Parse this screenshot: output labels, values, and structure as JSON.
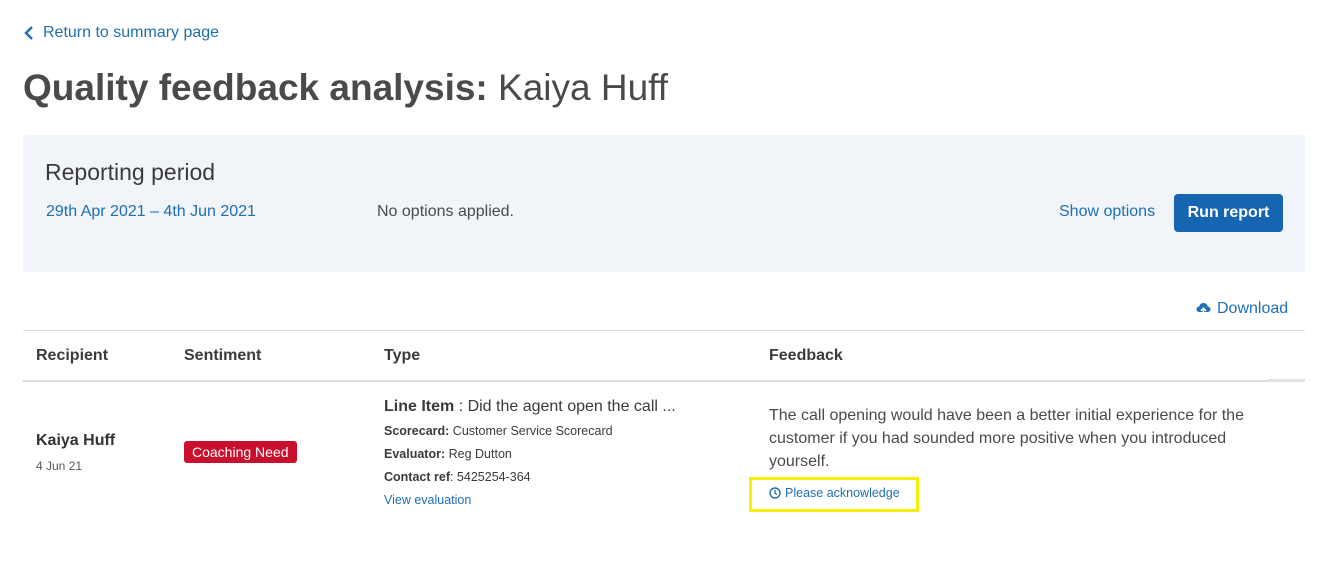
{
  "nav": {
    "back_label": "Return to summary page"
  },
  "page": {
    "title_bold": "Quality feedback analysis:",
    "title_name": "Kaiya Huff"
  },
  "period": {
    "heading": "Reporting period",
    "dates": "29th Apr 2021 – 4th Jun 2021",
    "options_status": "No options applied.",
    "show_options_label": "Show options",
    "run_report_label": "Run report"
  },
  "download_label": "Download",
  "table": {
    "headers": [
      "Recipient",
      "Sentiment",
      "Type",
      "Feedback"
    ],
    "rows": [
      {
        "recipient": "Kaiya Huff",
        "date": "4 Jun 21",
        "sentiment": "Coaching Need",
        "type_label": "Line Item",
        "type_value": " : Did the agent open the call ...",
        "scorecard_label": "Scorecard:",
        "scorecard_value": " Customer Service Scorecard",
        "evaluator_label": "Evaluator:",
        "evaluator_value": " Reg Dutton",
        "contact_label": "Contact ref",
        "contact_value": ": 5425254-364",
        "view_evaluation": "View evaluation",
        "feedback": "The call opening would have been a better initial experience for the customer if you had sounded more positive when you introduced yourself.",
        "acknowledge": "Please acknowledge"
      }
    ]
  },
  "colors": {
    "link": "#1f6fb2",
    "primary_button": "#1565b0",
    "badge": "#c8102e",
    "highlight": "#f5f000",
    "card_bg": "#f1f5f9"
  },
  "icons": {
    "back": "chevron-left-icon",
    "download": "cloud-upload-icon",
    "acknowledge": "clock-icon"
  }
}
